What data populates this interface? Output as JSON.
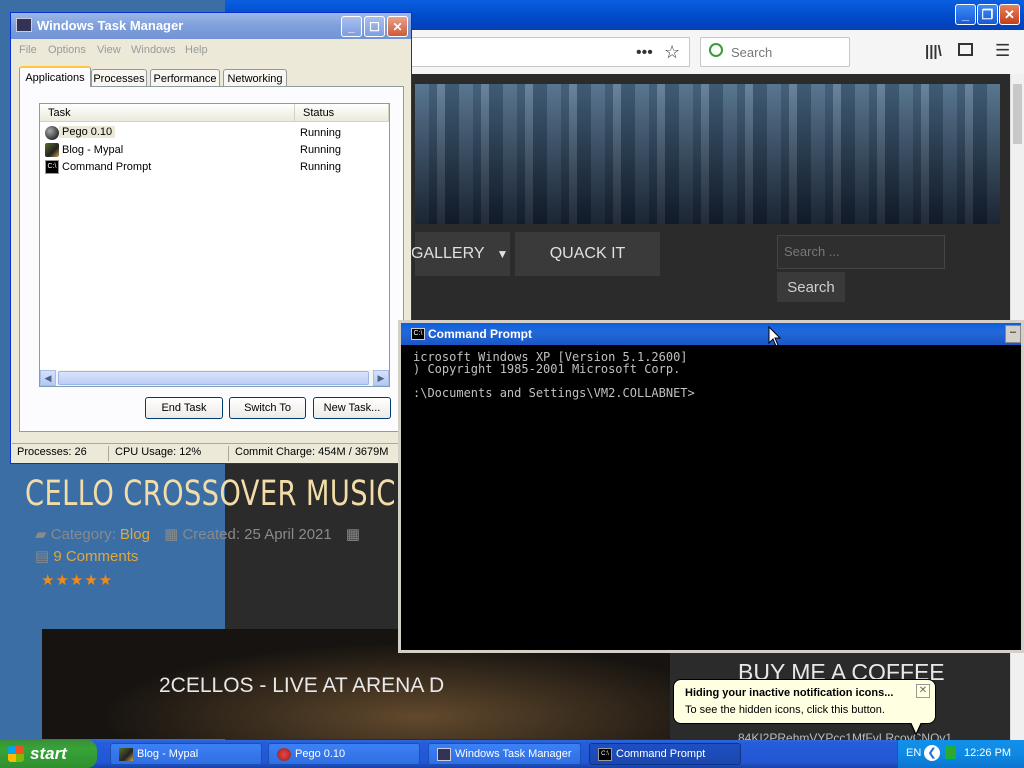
{
  "firefox": {
    "search_placeholder": "Search",
    "nav": {
      "gallery": "GALLERY",
      "quack": "QUACK IT"
    },
    "site_search": {
      "placeholder": "Search ...",
      "button": "Search"
    },
    "article": {
      "title": "CELLO CROSSOVER MUSIC -",
      "category_label": "Category:",
      "category_value": "Blog",
      "created": "Created: 25 April 2021",
      "comments": "9 Comments",
      "rating_stars": "★★★★★",
      "video_title": "2CELLOS - LIVE AT ARENA D"
    },
    "sidebar": {
      "coffee_title": "BUY ME A COFFEE",
      "coffee_code": "84KI2PRehmVYPcc1MfFvLRcoyCNQv1"
    }
  },
  "taskmanager": {
    "title": "Windows Task Manager",
    "menu": [
      "File",
      "Options",
      "View",
      "Windows",
      "Help"
    ],
    "tabs": [
      "Applications",
      "Processes",
      "Performance",
      "Networking"
    ],
    "columns": {
      "task": "Task",
      "status": "Status"
    },
    "rows": [
      {
        "task": "Pego 0.10",
        "status": "Running"
      },
      {
        "task": "Blog - Mypal",
        "status": "Running"
      },
      {
        "task": "Command Prompt",
        "status": "Running"
      }
    ],
    "buttons": {
      "end_task": "End Task",
      "switch_to": "Switch To",
      "new_task": "New Task..."
    },
    "status": {
      "processes": "Processes: 26",
      "cpu": "CPU Usage: 12%",
      "commit": "Commit Charge: 454M / 3679M"
    }
  },
  "cmd": {
    "title": "Command Prompt",
    "lines": [
      "icrosoft Windows XP [Version 5.1.2600]",
      ") Copyright 1985-2001 Microsoft Corp.",
      "",
      ":\\Documents and Settings\\VM2.COLLABNET>"
    ]
  },
  "taskbar": {
    "start": "start",
    "items": [
      "Blog - Mypal",
      "Pego 0.10",
      "Windows Task Manager",
      "Command Prompt"
    ],
    "lang": "EN",
    "clock": "12:26 PM"
  },
  "balloon": {
    "title": "Hiding your inactive notification icons...",
    "body": "To see the hidden icons, click this button."
  }
}
